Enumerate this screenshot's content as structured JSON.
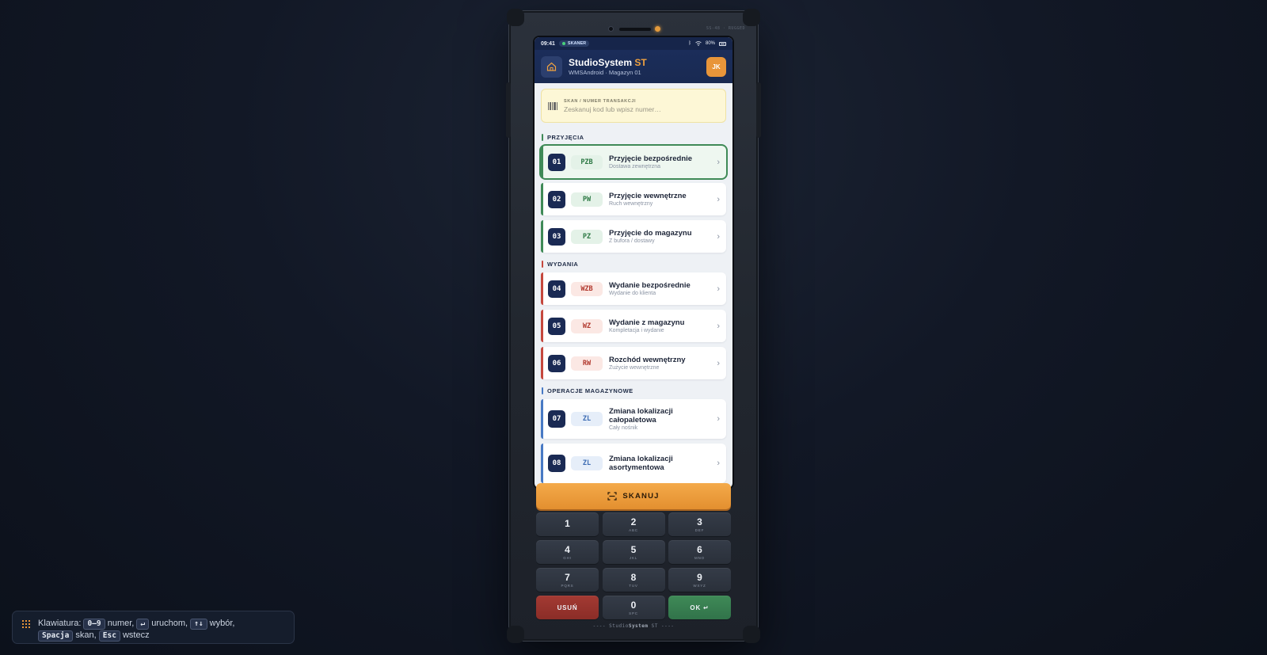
{
  "device": {
    "model": "SS-48 · RUGGED",
    "footer_brand_pre": "----  Studio",
    "footer_brand_bold": "System",
    "footer_brand_post": " ST  ----"
  },
  "statusbar": {
    "time": "09:41",
    "scanner_badge": "SKANER",
    "battery": "80%"
  },
  "header": {
    "title": "StudioSystem",
    "title_accent": "ST",
    "subtitle": "WMSAndroid · Magazyn 01",
    "avatar": "JK"
  },
  "scan_field": {
    "label": "SKAN / NUMER TRANSAKCJI",
    "placeholder": "Zeskanuj kod lub wpisz numer…"
  },
  "sections": {
    "receipts": "PRZYJĘCIA",
    "issues": "WYDANIA",
    "warehouse_ops": "OPERACJE MAGAZYNOWE"
  },
  "operations": [
    {
      "num": "01",
      "code": "PZB",
      "title": "Przyjęcie bezpośrednie",
      "subtitle": "Dostawa zewnętrzna"
    },
    {
      "num": "02",
      "code": "PW",
      "title": "Przyjęcie wewnętrzne",
      "subtitle": "Ruch wewnętrzny"
    },
    {
      "num": "03",
      "code": "PZ",
      "title": "Przyjęcie do magazynu",
      "subtitle": "Z bufora / dostawy"
    },
    {
      "num": "04",
      "code": "WZB",
      "title": "Wydanie bezpośrednie",
      "subtitle": "Wydanie do klienta"
    },
    {
      "num": "05",
      "code": "WZ",
      "title": "Wydanie z magazynu",
      "subtitle": "Kompletacja i wydanie"
    },
    {
      "num": "06",
      "code": "RW",
      "title": "Rozchód wewnętrzny",
      "subtitle": "Zużycie wewnętrzne"
    },
    {
      "num": "07",
      "code": "ZL",
      "title": "Zmiana lokalizacji całopaletowa",
      "subtitle": "Cały nośnik"
    },
    {
      "num": "08",
      "code": "ZL",
      "title": "Zmiana lokalizacji asortymentowa",
      "subtitle": ""
    }
  ],
  "scan_button": "SKANUJ",
  "keypad": [
    {
      "d": "1",
      "l": ""
    },
    {
      "d": "2",
      "l": "ABC"
    },
    {
      "d": "3",
      "l": "DEF"
    },
    {
      "d": "4",
      "l": "GHI"
    },
    {
      "d": "5",
      "l": "JKL"
    },
    {
      "d": "6",
      "l": "MNO"
    },
    {
      "d": "7",
      "l": "PQRS"
    },
    {
      "d": "8",
      "l": "TUV"
    },
    {
      "d": "9",
      "l": "WXYZ"
    },
    {
      "d": "USUŃ",
      "l": ""
    },
    {
      "d": "0",
      "l": "SPC"
    },
    {
      "d": "OK ↵",
      "l": ""
    }
  ],
  "hint": {
    "prefix": "Klawiatura:",
    "k1": "0–9",
    "t1": "numer,",
    "k2": "↵",
    "t2": "uruchom,",
    "k3": "↑↓",
    "t3": "wybór,",
    "k4": "Spacja",
    "t4": "skan,",
    "k5": "Esc",
    "t5": "wstecz"
  },
  "colors": {
    "receipts": "#3f8a57",
    "issues": "#c5473d",
    "warehouse_ops": "#4779c4",
    "accent": "#e8953a",
    "header": "#1b2d5a"
  }
}
